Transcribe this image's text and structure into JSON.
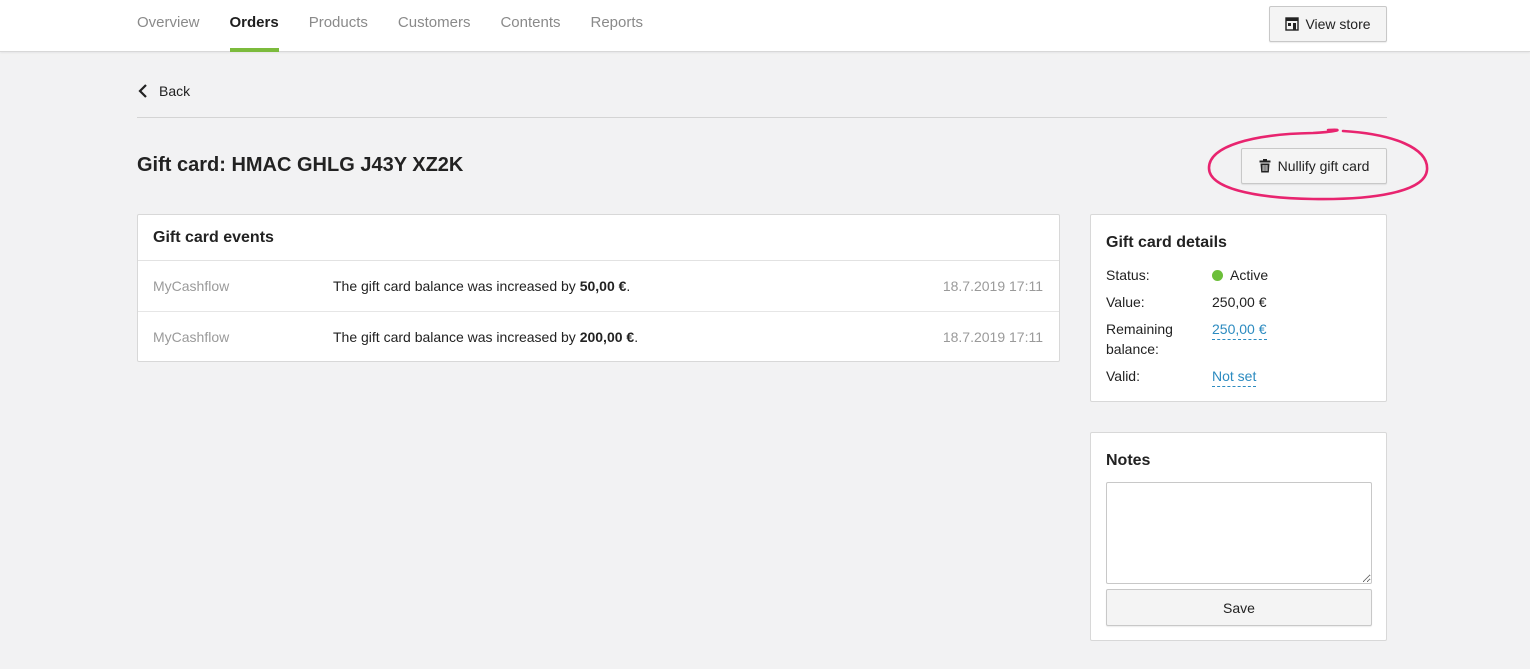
{
  "nav": {
    "items": [
      {
        "label": "Overview",
        "active": false
      },
      {
        "label": "Orders",
        "active": true
      },
      {
        "label": "Products",
        "active": false
      },
      {
        "label": "Customers",
        "active": false
      },
      {
        "label": "Contents",
        "active": false
      },
      {
        "label": "Reports",
        "active": false
      }
    ],
    "view_store_label": "View store",
    "view_store_icon": "store-icon",
    "accent_color": "#7cbb3c"
  },
  "back": {
    "label": "Back",
    "icon": "chevron-left-icon"
  },
  "page": {
    "title": "Gift card: HMAC GHLG J43Y XZ2K",
    "nullify_label": "Nullify gift card",
    "nullify_icon": "trash-icon",
    "highlight_color": "#e8246f"
  },
  "events": {
    "title": "Gift card events",
    "rows": [
      {
        "source": "MyCashflow",
        "text": "The gift card balance was increased by ",
        "amount": "50,00 €",
        "suffix": ".",
        "date": "18.7.2019 17:11"
      },
      {
        "source": "MyCashflow",
        "text": "The gift card balance was increased by ",
        "amount": "200,00 €",
        "suffix": ".",
        "date": "18.7.2019 17:11"
      }
    ]
  },
  "details": {
    "title": "Gift card details",
    "status_label": "Status:",
    "status_value": "Active",
    "status_color": "#6cbf3a",
    "value_label": "Value:",
    "value": "250,00 €",
    "remaining_label": "Remaining balance:",
    "remaining_value": "250,00 €",
    "valid_label": "Valid:",
    "valid_value": "Not set",
    "link_color": "#2c8bc0"
  },
  "notes": {
    "title": "Notes",
    "value": "",
    "save_label": "Save"
  }
}
